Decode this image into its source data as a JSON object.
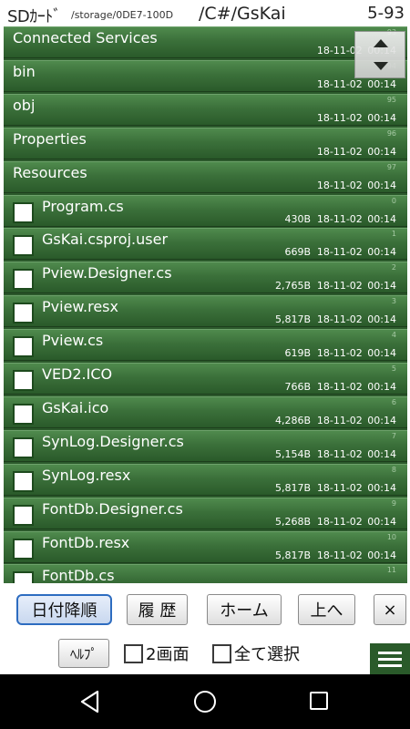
{
  "header": {
    "storage_label": "SDｶｰﾄﾞ",
    "path": "/storage/0DE7-100D",
    "dir": "/C#/GsKai",
    "count": "5-93"
  },
  "rows": [
    {
      "kind": "dir",
      "name": "Connected Services",
      "size": "",
      "date": "18-11-02 00:14",
      "index": "93"
    },
    {
      "kind": "dir",
      "name": "bin",
      "size": "",
      "date": "18-11-02 00:14",
      "index": "94"
    },
    {
      "kind": "dir",
      "name": "obj",
      "size": "",
      "date": "18-11-02 00:14",
      "index": "95"
    },
    {
      "kind": "dir",
      "name": "Properties",
      "size": "",
      "date": "18-11-02 00:14",
      "index": "96"
    },
    {
      "kind": "dir",
      "name": "Resources",
      "size": "",
      "date": "18-11-02 00:14",
      "index": "97"
    },
    {
      "kind": "file",
      "name": "Program.cs",
      "size": "430B",
      "date": "18-11-02 00:14",
      "index": "0"
    },
    {
      "kind": "file",
      "name": "GsKai.csproj.user",
      "size": "669B",
      "date": "18-11-02 00:14",
      "index": "1"
    },
    {
      "kind": "file",
      "name": "Pview.Designer.cs",
      "size": "2,765B",
      "date": "18-11-02 00:14",
      "index": "2"
    },
    {
      "kind": "file",
      "name": "Pview.resx",
      "size": "5,817B",
      "date": "18-11-02 00:14",
      "index": "3"
    },
    {
      "kind": "file",
      "name": "Pview.cs",
      "size": "619B",
      "date": "18-11-02 00:14",
      "index": "4"
    },
    {
      "kind": "file",
      "name": "VED2.ICO",
      "size": "766B",
      "date": "18-11-02 00:14",
      "index": "5"
    },
    {
      "kind": "file",
      "name": "GsKai.ico",
      "size": "4,286B",
      "date": "18-11-02 00:14",
      "index": "6"
    },
    {
      "kind": "file",
      "name": "SynLog.Designer.cs",
      "size": "5,154B",
      "date": "18-11-02 00:14",
      "index": "7"
    },
    {
      "kind": "file",
      "name": "SynLog.resx",
      "size": "5,817B",
      "date": "18-11-02 00:14",
      "index": "8"
    },
    {
      "kind": "file",
      "name": "FontDb.Designer.cs",
      "size": "5,268B",
      "date": "18-11-02 00:14",
      "index": "9"
    },
    {
      "kind": "file",
      "name": "FontDb.resx",
      "size": "5,817B",
      "date": "18-11-02 00:14",
      "index": "10"
    },
    {
      "kind": "file",
      "name": "FontDb.cs",
      "size": "",
      "date": "",
      "index": "11"
    }
  ],
  "toolbar": {
    "sort_label": "日付降順",
    "history_label": "履 歴",
    "home_label": "ホーム",
    "up_label": "上へ",
    "close_label": "×",
    "help_label": "ﾍﾙﾌﾟ",
    "dual_label": "2画面",
    "select_all_label": "全て選択"
  },
  "icons": {
    "scroll": "scroll-up-down-icon",
    "menu": "hamburger-menu-icon",
    "back": "back-triangle-icon",
    "home": "home-circle-icon",
    "recent": "recent-apps-square-icon"
  },
  "colors": {
    "row_green": "#3b703a",
    "active_border": "#2d6cc0",
    "navbar": "#000000"
  }
}
